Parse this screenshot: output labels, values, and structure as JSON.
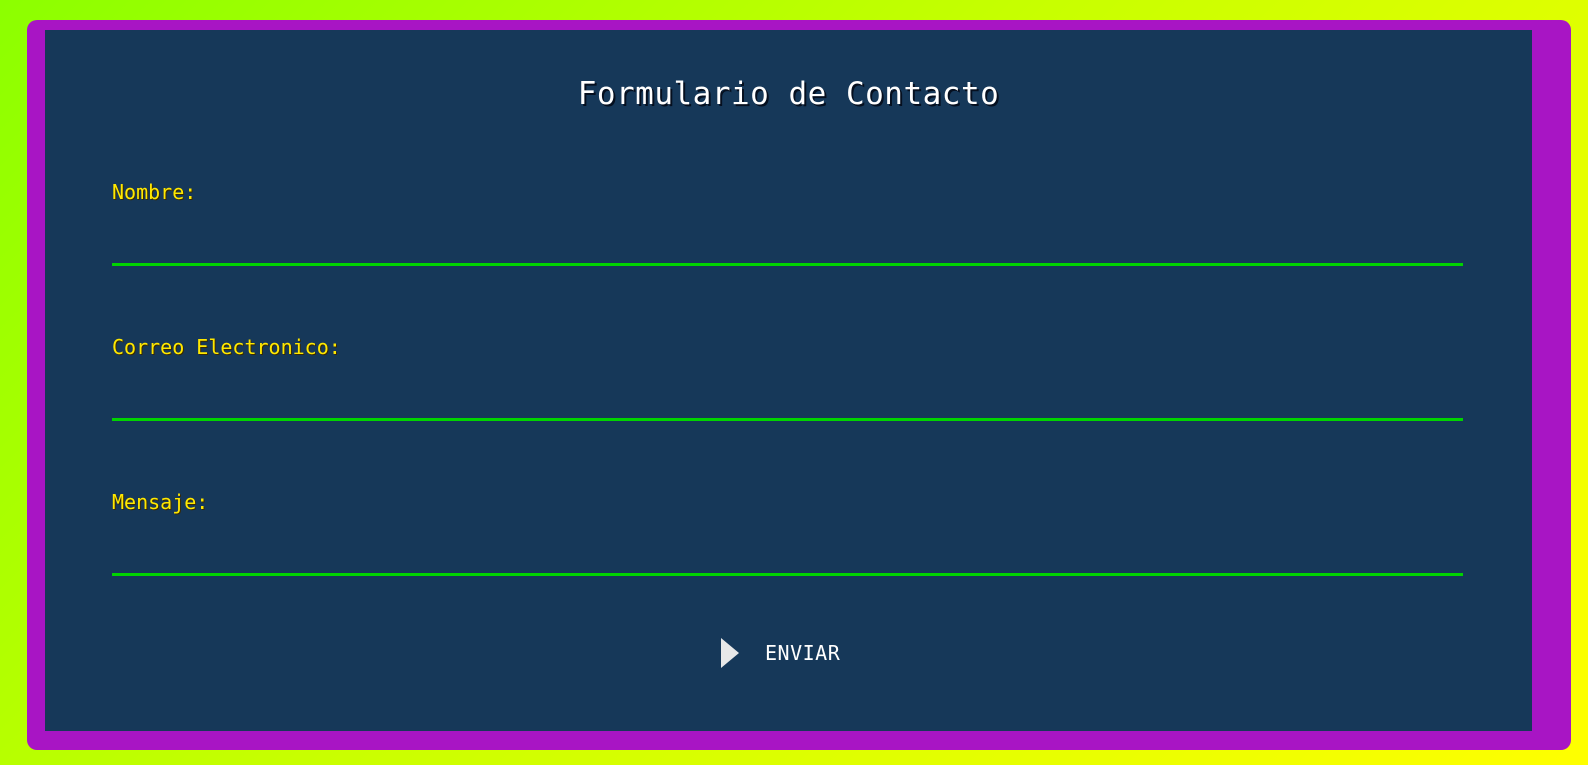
{
  "form": {
    "title": "Formulario de Contacto",
    "fields": [
      {
        "label": "Nombre:",
        "value": "",
        "placeholder": ""
      },
      {
        "label": "Correo Electronico:",
        "value": "",
        "placeholder": ""
      },
      {
        "label": "Mensaje:",
        "value": "",
        "placeholder": ""
      }
    ],
    "submit_label": "ENVIAR",
    "submit_icon": "play-triangle-icon"
  },
  "colors": {
    "background_gradient": [
      "#8cff00",
      "#ffff00"
    ],
    "frame": "#a815c4",
    "panel": "#163859",
    "label": "#ffe800",
    "underline": "#00d400",
    "text": "#ffffff"
  }
}
